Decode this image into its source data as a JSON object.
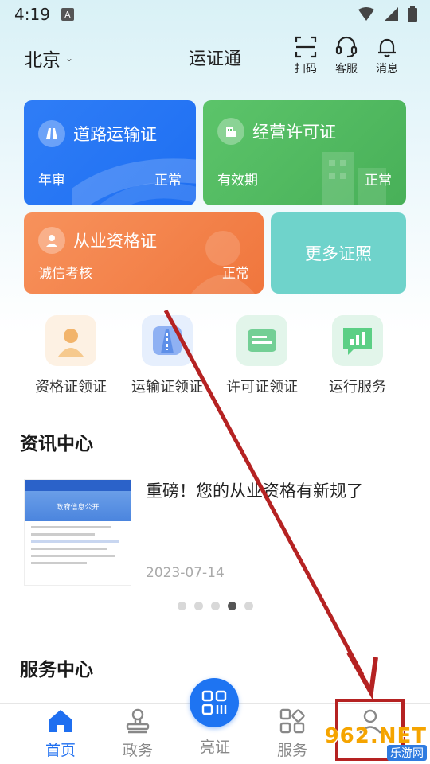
{
  "status_bar": {
    "time": "4:19",
    "badge": "A"
  },
  "header": {
    "city": "北京",
    "title": "运证通",
    "scan_label": "扫码",
    "service_label": "客服",
    "message_label": "消息"
  },
  "cards": {
    "road": {
      "title": "道路运输证",
      "sub": "年审",
      "status": "正常"
    },
    "business": {
      "title": "经营许可证",
      "sub": "有效期",
      "status": "正常"
    },
    "qualification": {
      "title": "从业资格证",
      "sub": "诚信考核",
      "status": "正常"
    },
    "more": {
      "title": "更多证照"
    }
  },
  "quick_actions": [
    {
      "label": "资格证领证",
      "icon": "person-card-icon"
    },
    {
      "label": "运输证领证",
      "icon": "road-icon"
    },
    {
      "label": "许可证领证",
      "icon": "license-icon"
    },
    {
      "label": "运行服务",
      "icon": "chart-chat-icon"
    }
  ],
  "news": {
    "section_title": "资讯中心",
    "headline": "重磅！您的从业资格有新规了",
    "date": "2023-07-14",
    "thumb_caption": "政府信息公开",
    "carousel_active_index": 3,
    "carousel_count": 5
  },
  "services": {
    "section_title": "服务中心"
  },
  "tabbar": {
    "home": "首页",
    "gov": "政务",
    "show": "亮证",
    "service": "服务",
    "mine": ""
  },
  "watermark": {
    "main": "962.NET",
    "sub": "乐游网"
  },
  "colors": {
    "primary": "#1f6ff0",
    "card_blue": "#2f7df6",
    "card_green": "#52bb62",
    "card_orange": "#f3844a",
    "card_teal": "#6fd3cb",
    "annotation": "#b52222"
  }
}
